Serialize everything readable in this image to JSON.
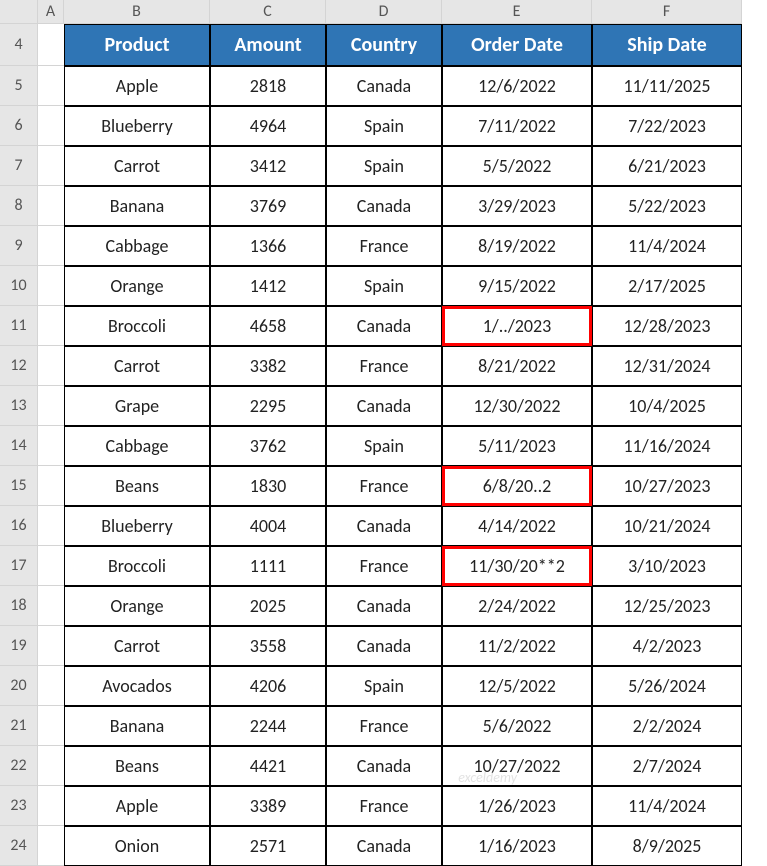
{
  "columns": [
    "A",
    "B",
    "C",
    "D",
    "E",
    "F"
  ],
  "rowStart": 4,
  "headers": [
    "Product",
    "Amount",
    "Country",
    "Order Date",
    "Ship Date"
  ],
  "rows": [
    {
      "product": "Apple",
      "amount": "2818",
      "country": "Canada",
      "order": "12/6/2022",
      "ship": "11/11/2025",
      "hl": false
    },
    {
      "product": "Blueberry",
      "amount": "4964",
      "country": "Spain",
      "order": "7/11/2022",
      "ship": "7/22/2023",
      "hl": false
    },
    {
      "product": "Carrot",
      "amount": "3412",
      "country": "Spain",
      "order": "5/5/2022",
      "ship": "6/21/2023",
      "hl": false
    },
    {
      "product": "Banana",
      "amount": "3769",
      "country": "Canada",
      "order": "3/29/2023",
      "ship": "5/22/2023",
      "hl": false
    },
    {
      "product": "Cabbage",
      "amount": "1366",
      "country": "France",
      "order": "8/19/2022",
      "ship": "11/4/2024",
      "hl": false
    },
    {
      "product": "Orange",
      "amount": "1412",
      "country": "Spain",
      "order": "9/15/2022",
      "ship": "2/17/2025",
      "hl": false
    },
    {
      "product": "Broccoli",
      "amount": "4658",
      "country": "Canada",
      "order": "1/../2023",
      "ship": "12/28/2023",
      "hl": true
    },
    {
      "product": "Carrot",
      "amount": "3382",
      "country": "France",
      "order": "8/21/2022",
      "ship": "12/31/2024",
      "hl": false
    },
    {
      "product": "Grape",
      "amount": "2295",
      "country": "Canada",
      "order": "12/30/2022",
      "ship": "10/4/2025",
      "hl": false
    },
    {
      "product": "Cabbage",
      "amount": "3762",
      "country": "Spain",
      "order": "5/11/2023",
      "ship": "11/16/2024",
      "hl": false
    },
    {
      "product": "Beans",
      "amount": "1830",
      "country": "France",
      "order": "6/8/20..2",
      "ship": "10/27/2023",
      "hl": true
    },
    {
      "product": "Blueberry",
      "amount": "4004",
      "country": "Canada",
      "order": "4/14/2022",
      "ship": "10/21/2024",
      "hl": false
    },
    {
      "product": "Broccoli",
      "amount": "1111",
      "country": "France",
      "order": "11/30/20**2",
      "ship": "3/10/2023",
      "hl": true
    },
    {
      "product": "Orange",
      "amount": "2025",
      "country": "Canada",
      "order": "2/24/2022",
      "ship": "12/25/2023",
      "hl": false
    },
    {
      "product": "Carrot",
      "amount": "3558",
      "country": "Canada",
      "order": "11/2/2022",
      "ship": "4/2/2023",
      "hl": false
    },
    {
      "product": "Avocados",
      "amount": "4206",
      "country": "Spain",
      "order": "12/5/2022",
      "ship": "5/26/2024",
      "hl": false
    },
    {
      "product": "Banana",
      "amount": "2244",
      "country": "France",
      "order": "5/6/2022",
      "ship": "2/2/2024",
      "hl": false
    },
    {
      "product": "Beans",
      "amount": "4421",
      "country": "Canada",
      "order": "10/27/2022",
      "ship": "2/7/2024",
      "hl": false
    },
    {
      "product": "Apple",
      "amount": "3389",
      "country": "France",
      "order": "1/26/2023",
      "ship": "11/4/2024",
      "hl": false
    },
    {
      "product": "Onion",
      "amount": "2571",
      "country": "Canada",
      "order": "1/16/2023",
      "ship": "8/9/2025",
      "hl": false
    }
  ],
  "watermark": "exceldemy"
}
